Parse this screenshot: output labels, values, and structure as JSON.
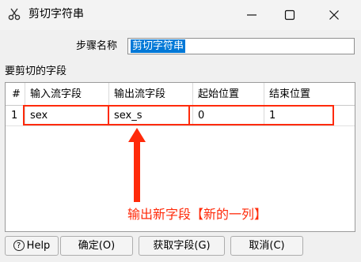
{
  "window": {
    "title": "剪切字符串",
    "app_icon": "scissors-icon",
    "controls": [
      "minimize-icon",
      "maximize-icon",
      "close-icon"
    ]
  },
  "step": {
    "label": "步骤名称",
    "value": "剪切字符串"
  },
  "fields_section": {
    "label": "要剪切的字段"
  },
  "grid": {
    "columns": [
      "#",
      "输入流字段",
      "输出流字段",
      "起始位置",
      "结束位置"
    ],
    "rows": [
      {
        "index": "1",
        "input_field": "sex",
        "output_field": "sex_s",
        "start": "0",
        "end": "1"
      }
    ]
  },
  "annotation": {
    "text": "输出新字段【新的一列】",
    "color": "#ff2a0a"
  },
  "buttons": {
    "help": "Help",
    "ok": "确定(O)",
    "get_fields": "获取字段(G)",
    "cancel": "取消(C)"
  },
  "colors": {
    "selection": "#0078d7",
    "highlight": "#ff2a0a",
    "background": "#f0f0f0"
  }
}
